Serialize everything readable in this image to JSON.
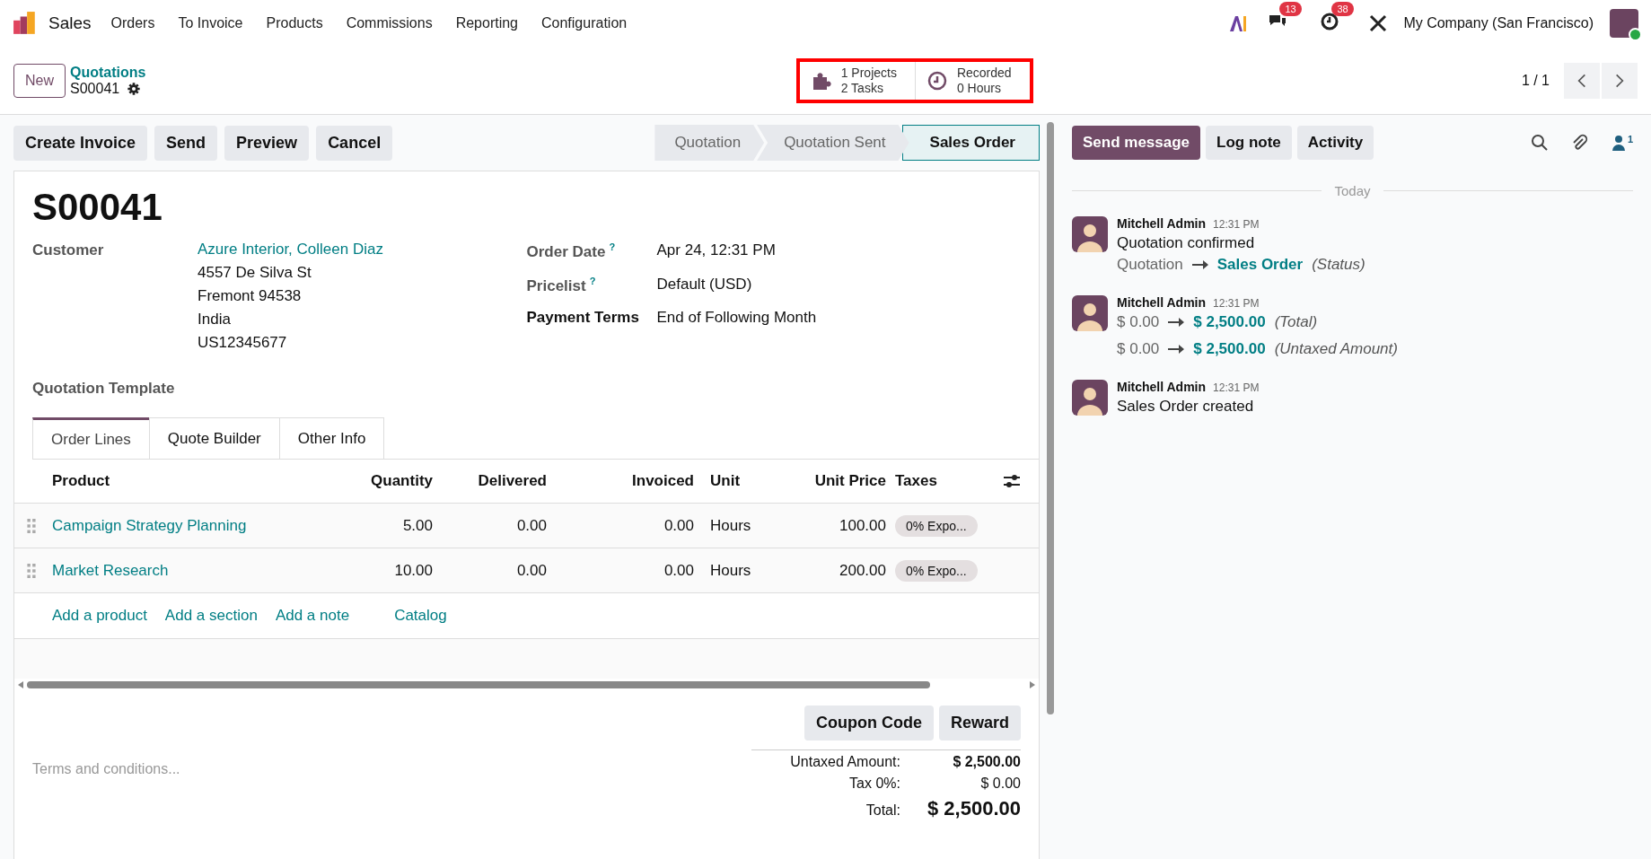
{
  "navbar": {
    "app": "Sales",
    "menu": [
      "Orders",
      "To Invoice",
      "Products",
      "Commissions",
      "Reporting",
      "Configuration"
    ],
    "messages_count": "13",
    "activities_count": "38",
    "company": "My Company (San Francisco)"
  },
  "control_panel": {
    "new_button": "New",
    "breadcrumb": "Quotations",
    "record": "S00041",
    "stats": [
      {
        "kind": "projects",
        "line_1": "1  Projects",
        "line_2": "2  Tasks"
      },
      {
        "kind": "clock",
        "line_1": "Recorded",
        "line_2": "0 Hours"
      }
    ],
    "pager": "1 / 1"
  },
  "actions": [
    "Create Invoice",
    "Send",
    "Preview",
    "Cancel"
  ],
  "statusbar": [
    {
      "label": "Quotation",
      "selected": false
    },
    {
      "label": "Quotation Sent",
      "selected": false
    },
    {
      "label": "Sales Order",
      "selected": true
    }
  ],
  "form": {
    "title": "S00041",
    "left_fields": [
      {
        "label": "Customer",
        "value": "Azure Interior, Colleen Diaz",
        "address": [
          "4557 De Silva St",
          "Fremont 94538",
          "India",
          "US12345677"
        ]
      },
      {
        "label": "Quotation Template"
      }
    ],
    "right_fields": [
      {
        "label": "Order Date",
        "help": "?",
        "value": "Apr 24, 12:31 PM"
      },
      {
        "label": "Pricelist",
        "help": "?",
        "value": "Default (USD)"
      },
      {
        "label": "Payment Terms",
        "value": "End of Following Month"
      }
    ],
    "tabs": [
      {
        "label": "Order Lines",
        "selected": true
      },
      {
        "label": "Quote Builder",
        "selected": false
      },
      {
        "label": "Other Info",
        "selected": false
      }
    ],
    "table": {
      "columns": [
        "Product",
        "Quantity",
        "Delivered",
        "Invoiced",
        "Unit",
        "Unit Price",
        "Taxes"
      ],
      "rows": [
        [
          "Campaign Strategy Planning",
          "5.00",
          "0.00",
          "0.00",
          "Hours",
          "100.00",
          "0% Expo..."
        ],
        [
          "Market Research",
          "10.00",
          "0.00",
          "0.00",
          "Hours",
          "200.00",
          "0% Expo..."
        ]
      ]
    },
    "add_links": [
      "Add a product",
      "Add a section",
      "Add a note",
      "Catalog"
    ],
    "buttons": [
      "Coupon Code",
      "Reward"
    ],
    "terms_placeholder": "Terms and conditions...",
    "totals": [
      {
        "label": "Untaxed Amount:",
        "value": "$ 2,500.00",
        "kind": "bold"
      },
      {
        "label": "Tax 0%:",
        "value": "$ 0.00",
        "kind": "plain"
      },
      {
        "label": "Total:",
        "value": "$ 2,500.00",
        "kind": "grand"
      }
    ]
  },
  "chatter": {
    "buttons": [
      {
        "label": "Send message",
        "selected": true
      },
      {
        "label": "Log note",
        "selected": false
      },
      {
        "label": "Activity",
        "selected": false
      }
    ],
    "followers": "1",
    "date_label": "Today",
    "messages": [
      {
        "author": "Mitchell Admin",
        "time": "12:31 PM",
        "body": "Quotation confirmed",
        "changes": [
          {
            "old": "Quotation",
            "new": "Sales Order",
            "field": "(Status)"
          }
        ]
      },
      {
        "author": "Mitchell Admin",
        "time": "12:31 PM",
        "changes": [
          {
            "old": "$ 0.00",
            "new": "$ 2,500.00",
            "field": "(Total)"
          },
          {
            "old": "$ 0.00",
            "new": "$ 2,500.00",
            "field": "(Untaxed Amount)"
          }
        ]
      },
      {
        "author": "Mitchell Admin",
        "time": "12:31 PM",
        "body": "Sales Order created"
      }
    ]
  }
}
